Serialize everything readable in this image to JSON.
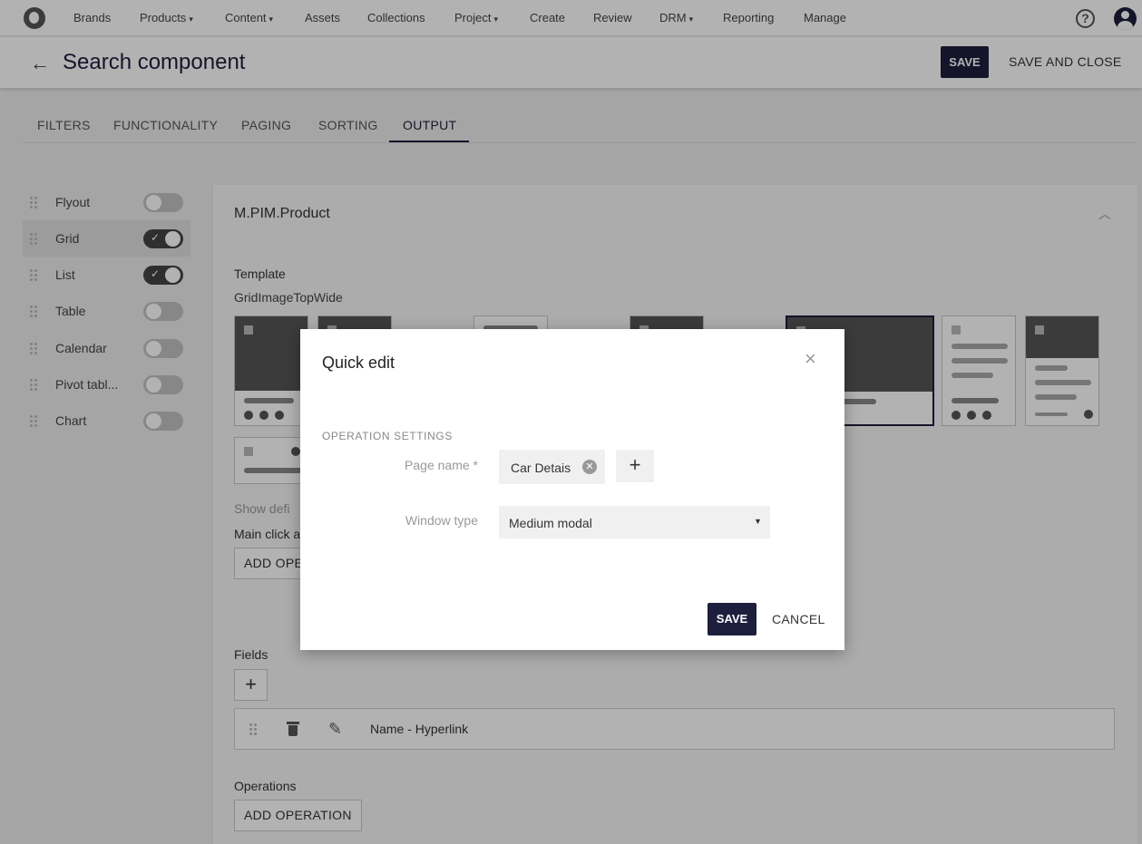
{
  "nav": {
    "items": [
      {
        "label": "Brands",
        "caret": ""
      },
      {
        "label": "Products",
        "caret": "▾"
      },
      {
        "label": "Content",
        "caret": "▾"
      },
      {
        "label": "Assets",
        "caret": ""
      },
      {
        "label": "Collections",
        "caret": ""
      },
      {
        "label": "Project",
        "caret": "▾"
      },
      {
        "label": "Create",
        "caret": ""
      },
      {
        "label": "Review",
        "caret": ""
      },
      {
        "label": "DRM",
        "caret": "▾"
      },
      {
        "label": "Reporting",
        "caret": ""
      },
      {
        "label": "Manage",
        "caret": ""
      }
    ],
    "help_glyph": "?"
  },
  "header": {
    "back_glyph": "←",
    "title": "Search component",
    "save": "SAVE",
    "save_and_close": "SAVE AND CLOSE"
  },
  "tabs": [
    {
      "label": "FILTERS"
    },
    {
      "label": "FUNCTIONALITY"
    },
    {
      "label": "PAGING"
    },
    {
      "label": "SORTING"
    },
    {
      "label": "OUTPUT",
      "active": true
    }
  ],
  "sidebar": {
    "items": [
      {
        "label": "Flyout",
        "on": false
      },
      {
        "label": "Grid",
        "on": true
      },
      {
        "label": "List",
        "on": true
      },
      {
        "label": "Table",
        "on": false
      },
      {
        "label": "Calendar",
        "on": false
      },
      {
        "label": "Pivot tabl...",
        "on": false
      },
      {
        "label": "Chart",
        "on": false
      }
    ],
    "active_index": 1
  },
  "main": {
    "entity": "M.PIM.Product",
    "template_label": "Template",
    "template_value": "GridImageTopWide",
    "selected_template_index": 4,
    "show_defaults_label": "Show defi",
    "main_click_label": "Main click a",
    "add_operation_partial": "ADD OPE",
    "fields_label": "Fields",
    "field_row": {
      "name": "Name  - Hyperlink"
    },
    "operations_label": "Operations",
    "add_operation": "ADD OPERATION"
  },
  "modal": {
    "title": "Quick edit",
    "close_glyph": "×",
    "section": "OPERATION SETTINGS",
    "page_name_label": "Page name *",
    "page_name_value": "Car Detais",
    "add_glyph": "+",
    "window_type_label": "Window type",
    "window_type_value": "Medium modal",
    "save": "SAVE",
    "cancel": "CANCEL"
  },
  "colors": {
    "primary": "#1e1f3d",
    "toggle_on": "#444444",
    "toggle_off": "#c2c2c2"
  }
}
